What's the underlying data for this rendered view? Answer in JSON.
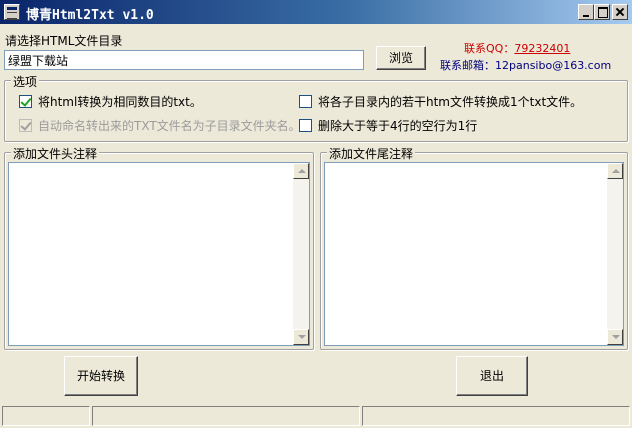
{
  "window": {
    "title": "博青Html2Txt v1.0"
  },
  "top": {
    "dir_label": "请选择HTML文件目录",
    "dir_value": "绿盟下载站",
    "browse_label": "浏览",
    "qq_label": "联系QQ：",
    "qq_number": "79232401",
    "mail_label": "联系邮箱：",
    "mail_value": "12pansibo@163.com"
  },
  "options": {
    "legend": "选项",
    "items": [
      {
        "label": "将html转换为相同数目的txt。",
        "checked": true,
        "enabled": true
      },
      {
        "label": "自动命名转出来的TXT文件名为子目录文件夹名。",
        "checked": true,
        "enabled": false
      },
      {
        "label": "将各子目录内的若干htm文件转换成1个txt文件。",
        "checked": false,
        "enabled": true
      },
      {
        "label": "删除大于等于4行的空行为1行",
        "checked": false,
        "enabled": true
      }
    ]
  },
  "header_box": {
    "legend": "添加文件头注释",
    "value": ""
  },
  "footer_box": {
    "legend": "添加文件尾注释",
    "value": ""
  },
  "buttons": {
    "start": "开始转换",
    "exit": "退出"
  },
  "status": [
    "",
    "",
    ""
  ]
}
